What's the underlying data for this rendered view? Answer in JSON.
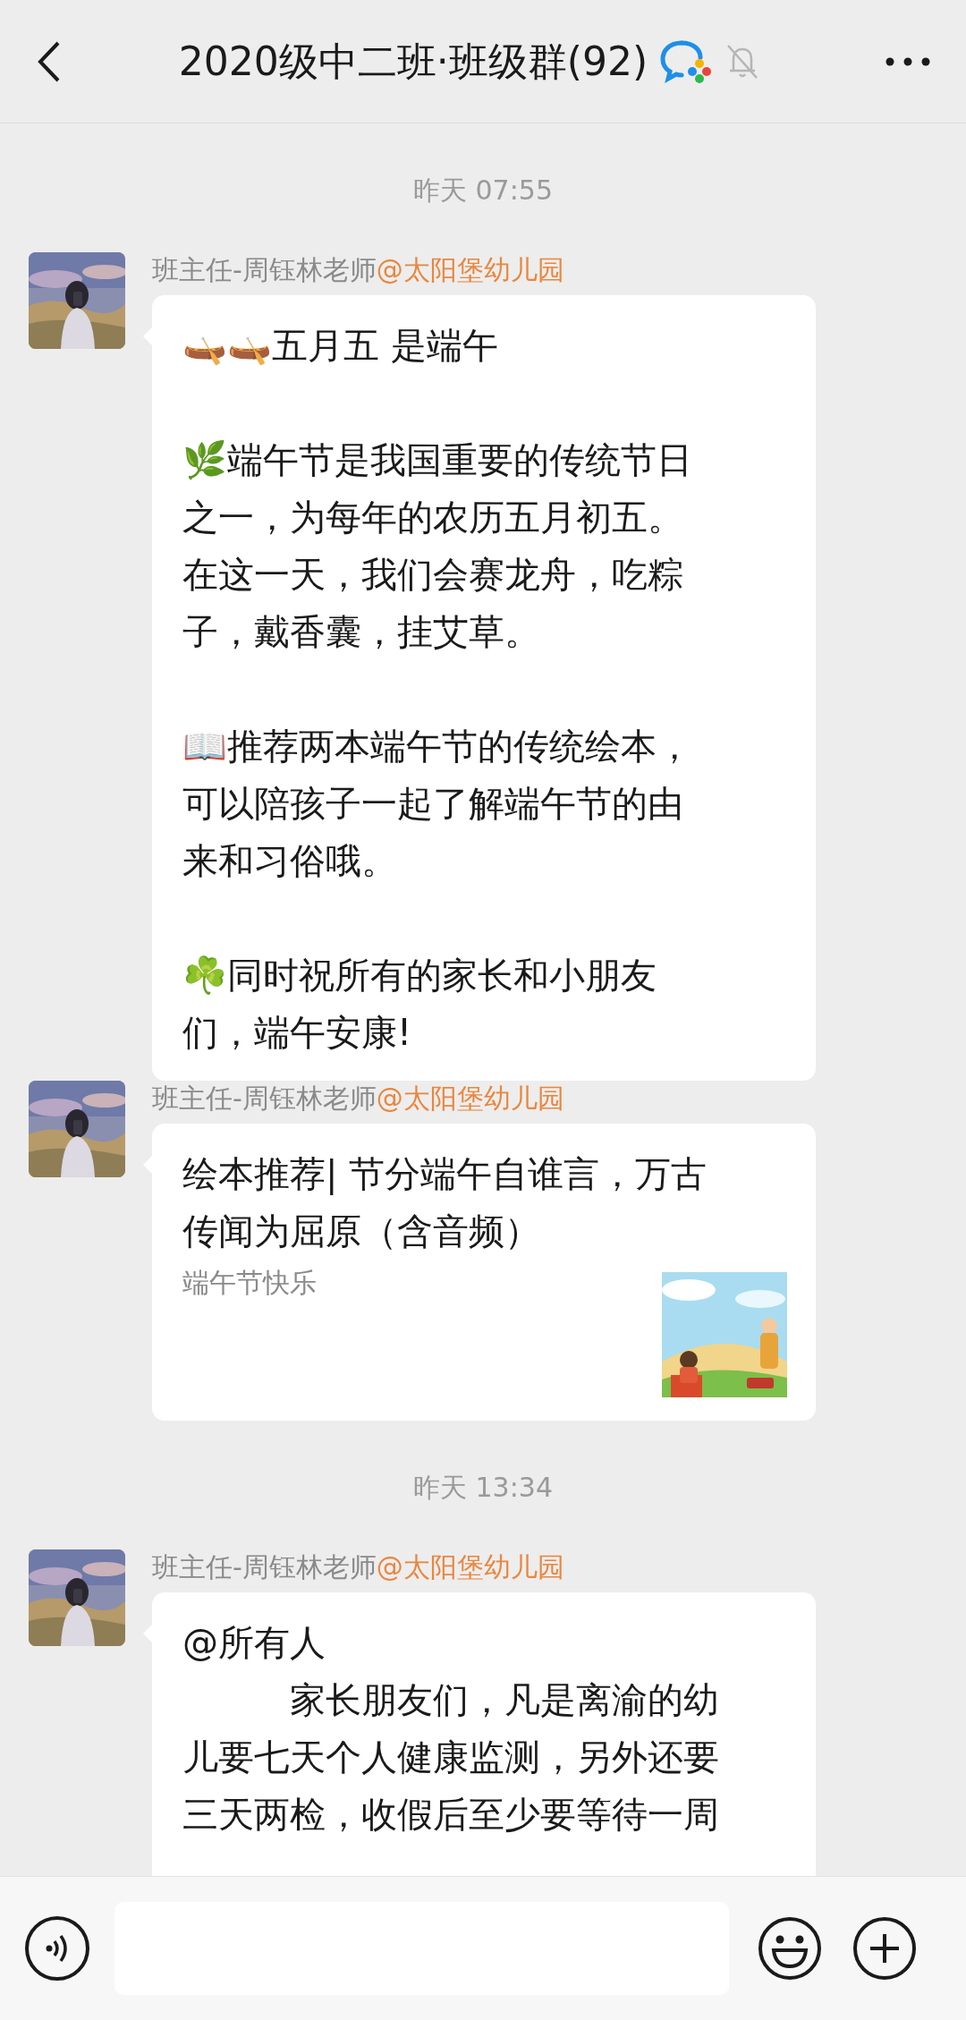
{
  "header": {
    "title": "2020级中二班·班级群(92)"
  },
  "messages": [
    {
      "kind": "timestamp",
      "text": "昨天 07:55"
    },
    {
      "kind": "text",
      "sender": "班主任-周钰林老师",
      "org": "@太阳堡幼儿园",
      "paragraphs": [
        {
          "blank_before": false,
          "indent": false,
          "lines": [
            "🛶🛶五月五  是端午"
          ]
        },
        {
          "blank_before": true,
          "indent": false,
          "lines": [
            "🌿端午节是我国重要的传统节日",
            "之一，为每年的农历五月初五。",
            "在这一天，我们会赛龙舟，吃粽",
            "子，戴香囊，挂艾草。"
          ]
        },
        {
          "blank_before": true,
          "indent": false,
          "lines": [
            "📖推荐两本端午节的传统绘本，",
            "可以陪孩子一起了解端午节的由",
            "来和习俗哦。"
          ]
        },
        {
          "blank_before": true,
          "indent": false,
          "lines": [
            "☘️同时祝所有的家长和小朋友",
            "们，端午安康!"
          ]
        }
      ]
    },
    {
      "kind": "link",
      "sender": "班主任-周钰林老师",
      "org": "@太阳堡幼儿园",
      "title_lines": [
        "绘本推荐| 节分端午自谁言，万古",
        "传闻为屈原（含音频）"
      ],
      "description": "端午节快乐"
    },
    {
      "kind": "timestamp",
      "text": "昨天 13:34"
    },
    {
      "kind": "text",
      "sender": "班主任-周钰林老师",
      "org": "@太阳堡幼儿园",
      "paragraphs": [
        {
          "blank_before": false,
          "indent": false,
          "lines": [
            "@所有人"
          ]
        },
        {
          "blank_before": false,
          "indent": true,
          "lines": [
            "家长朋友们，凡是离渝的幼",
            "儿要七天个人健康监测，另外还要",
            "三天两检，收假后至少要等待一周"
          ]
        }
      ]
    }
  ]
}
